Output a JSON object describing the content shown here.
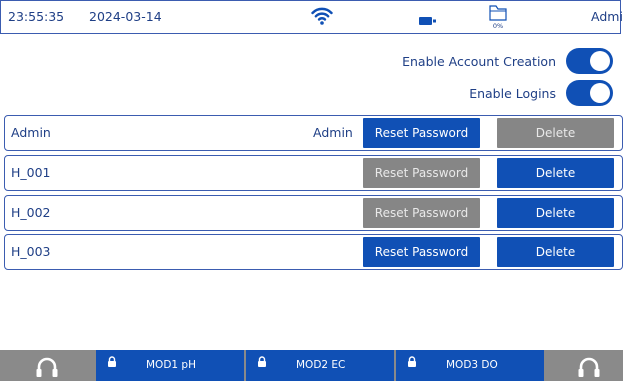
{
  "status": {
    "time": "23:55:35",
    "date": "2024-03-14",
    "folder_pct": "0%",
    "user": "Admin",
    "icons": [
      "wifi-icon",
      "battery-icon",
      "folder-icon"
    ]
  },
  "settings": {
    "enable_account_creation": {
      "label": "Enable Account Creation",
      "on": true
    },
    "enable_logins": {
      "label": "Enable Logins",
      "on": true
    }
  },
  "users": [
    {
      "name": "Admin",
      "role": "Admin",
      "reset_label": "Reset Password",
      "reset_enabled": true,
      "delete_label": "Delete",
      "delete_enabled": false
    },
    {
      "name": "H_001",
      "role": "",
      "reset_label": "Reset Password",
      "reset_enabled": false,
      "delete_label": "Delete",
      "delete_enabled": true
    },
    {
      "name": "H_002",
      "role": "",
      "reset_label": "Reset Password",
      "reset_enabled": false,
      "delete_label": "Delete",
      "delete_enabled": true
    },
    {
      "name": "H_003",
      "role": "",
      "reset_label": "Reset Password",
      "reset_enabled": true,
      "delete_label": "Delete",
      "delete_enabled": true
    }
  ],
  "modules": [
    {
      "label": "MOD1 pH",
      "icon": "lock-icon"
    },
    {
      "label": "MOD2 EC",
      "icon": "lock-icon"
    },
    {
      "label": "MOD3 DO",
      "icon": "lock-icon"
    }
  ],
  "colors": {
    "accent": "#1050b5",
    "disabled": "#868686",
    "bottom_bar": "#8a8a8a",
    "border": "#3b5cb0"
  }
}
